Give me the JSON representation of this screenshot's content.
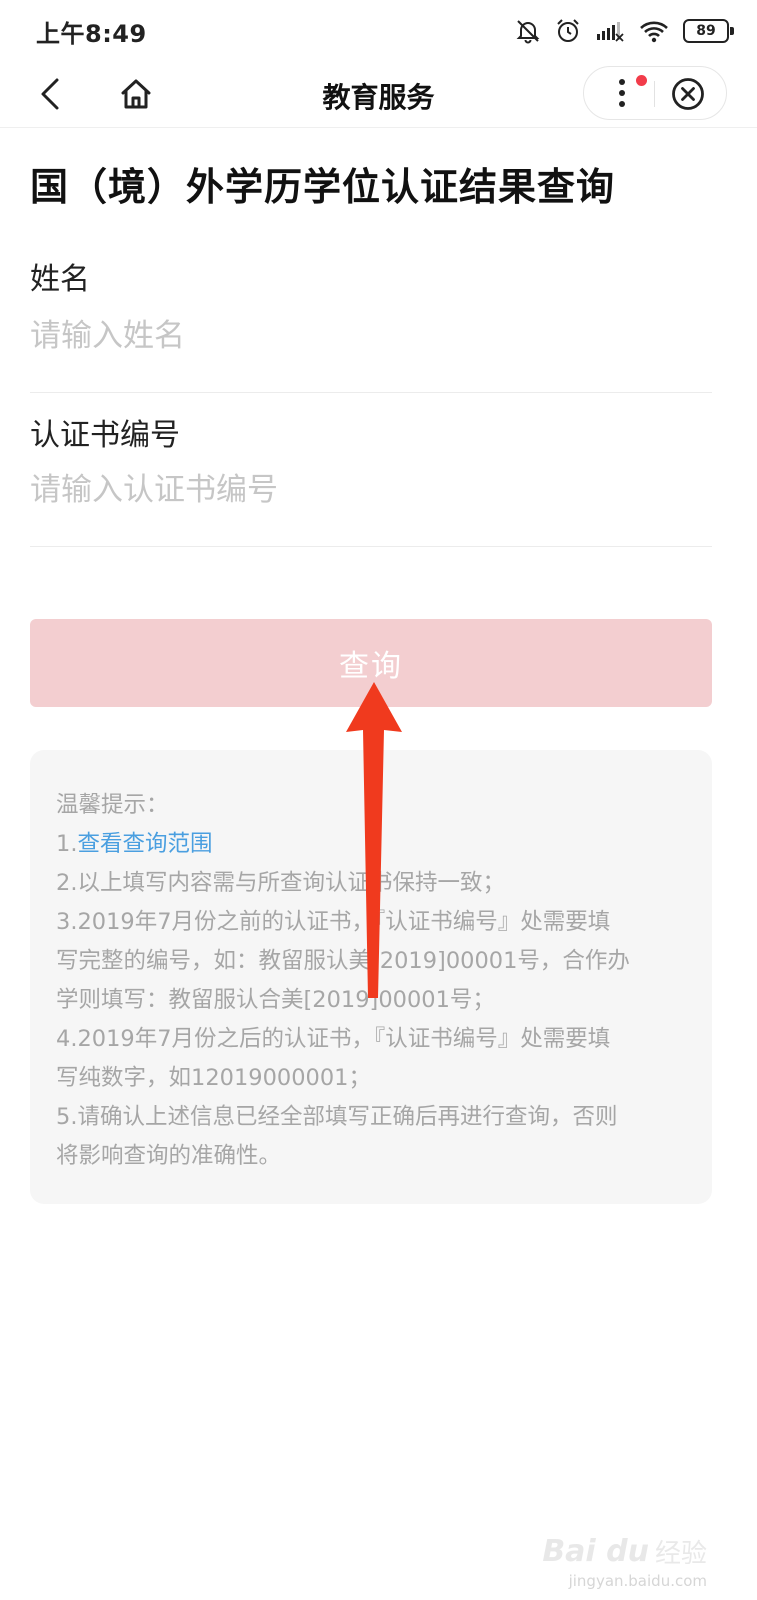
{
  "status_bar": {
    "time": "上午8:49",
    "battery": "89"
  },
  "nav": {
    "title": "教育服务"
  },
  "page": {
    "title": "国（境）外学历学位认证结果查询"
  },
  "form": {
    "name_label": "姓名",
    "name_placeholder": "请输入姓名",
    "cert_label": "认证书编号",
    "cert_placeholder": "请输入认证书编号",
    "submit_label": "查询"
  },
  "tips": {
    "heading": "温馨提示：",
    "item1_prefix": "1.",
    "item1_link": "查看查询范围",
    "lines": [
      "2.以上填写内容需与所查询认证书保持一致；",
      "3.2019年7月份之前的认证书，『认证书编号』处需要填",
      "写完整的编号，如：教留服认美[2019]00001号，合作办",
      "学则填写：教留服认合美[2019]00001号；",
      "4.2019年7月份之后的认证书，『认证书编号』处需要填",
      "写纯数字，如12019000001；",
      "5.请确认上述信息已经全部填写正确后再进行查询，否则",
      "将影响查询的准确性。"
    ]
  },
  "watermark": {
    "brand": "Bai du",
    "text": "经验",
    "url": "jingyan.baidu.com"
  },
  "colors": {
    "button_bg": "#f3ced0",
    "link": "#4a9fe0",
    "annotation_arrow": "#f03a1e",
    "badge": "#f23c4a"
  }
}
